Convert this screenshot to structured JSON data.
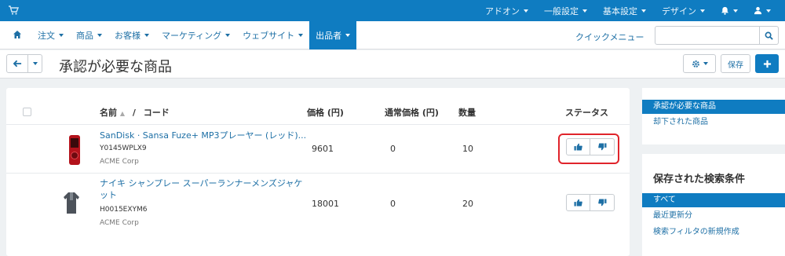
{
  "colors": {
    "accent": "#0f7cc1",
    "highlight": "#e0242b"
  },
  "topbar": {
    "cart_icon": "cart-icon",
    "menu": [
      {
        "label": "アドオン"
      },
      {
        "label": "一般設定"
      },
      {
        "label": "基本設定"
      },
      {
        "label": "デザイン"
      }
    ],
    "bell_icon": "bell-icon",
    "user_icon": "user-icon"
  },
  "nav": {
    "home_icon": "home-icon",
    "items": [
      {
        "label": "注文"
      },
      {
        "label": "商品"
      },
      {
        "label": "お客様"
      },
      {
        "label": "マーケティング"
      },
      {
        "label": "ウェブサイト"
      },
      {
        "label": "出品者"
      }
    ],
    "active_index": 5,
    "quick_menu": "クイックメニュー",
    "search_placeholder": ""
  },
  "header": {
    "title": "承認が必要な商品",
    "save_label": "保存"
  },
  "table": {
    "columns": {
      "name": "名前",
      "sort_sep": "/",
      "code": "コード",
      "price": "価格 (円)",
      "list_price": "通常価格 (円)",
      "quantity": "数量",
      "status": "ステータス"
    },
    "rows": [
      {
        "name": "SanDisk · Sansa Fuze+ MP3プレーヤー (レッド)...",
        "code": "Y0145WPLX9",
        "vendor": "ACME Corp",
        "price": "9601",
        "list_price": "0",
        "quantity": "10"
      },
      {
        "name_line1": "ナイキ シャンプレー スーパーランナーメンズジャケ",
        "name_line2": "ット",
        "code": "H0015EXYM6",
        "vendor": "ACME Corp",
        "price": "18001",
        "list_price": "0",
        "quantity": "20"
      }
    ]
  },
  "sidebar": {
    "views": [
      {
        "label": "承認が必要な商品"
      },
      {
        "label": "却下された商品"
      }
    ],
    "saved_search_title": "保存された検索条件",
    "saved": [
      {
        "label": "すべて"
      },
      {
        "label": "最近更新分"
      },
      {
        "label": "検索フィルタの新規作成"
      }
    ]
  }
}
